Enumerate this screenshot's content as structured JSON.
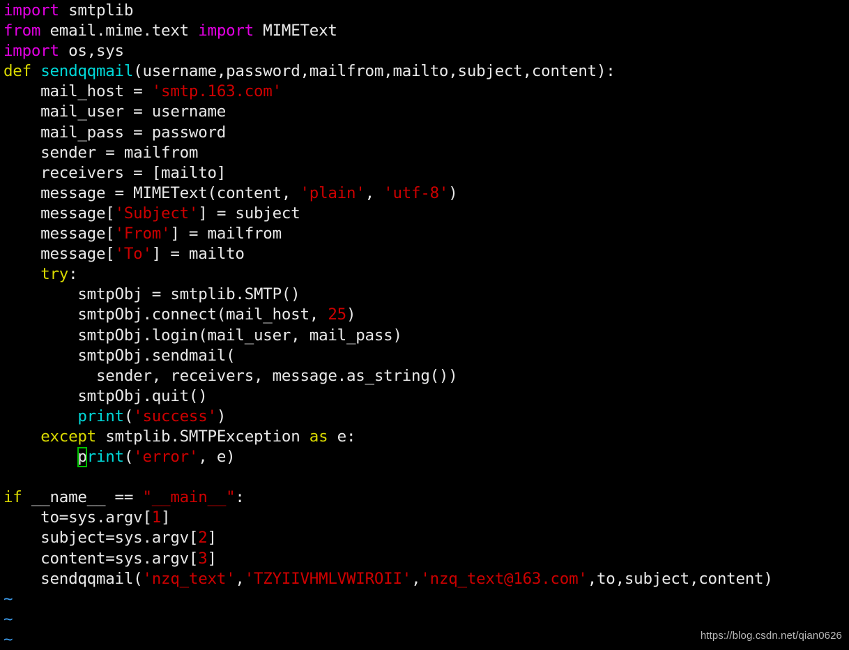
{
  "editor": {
    "app": "vim",
    "language": "python",
    "background_color": "#000000",
    "default_text_color": "#e8e8e8",
    "cursor": {
      "character": "p",
      "line": 21,
      "column": 9,
      "style": "hollow-box",
      "color": "#00c000"
    },
    "palette": {
      "keyword": "#d8d800",
      "import": "#e000e0",
      "function": "#00d7d7",
      "string": "#cc0000",
      "number": "#cc0000",
      "plain": "#e8e8e8",
      "tilde": "#3c9ae8"
    }
  },
  "code": {
    "lines": [
      [
        {
          "t": "import",
          "c": "imp"
        },
        {
          "t": " smtplib",
          "c": "plain"
        }
      ],
      [
        {
          "t": "from",
          "c": "imp"
        },
        {
          "t": " email.mime.text ",
          "c": "plain"
        },
        {
          "t": "import",
          "c": "imp"
        },
        {
          "t": " MIMEText",
          "c": "plain"
        }
      ],
      [
        {
          "t": "import",
          "c": "imp"
        },
        {
          "t": " os,sys",
          "c": "plain"
        }
      ],
      [
        {
          "t": "def",
          "c": "kw"
        },
        {
          "t": " ",
          "c": "plain"
        },
        {
          "t": "sendqqmail",
          "c": "fn"
        },
        {
          "t": "(username,password,mailfrom,mailto,subject,content):",
          "c": "plain"
        }
      ],
      [
        {
          "t": "    mail_host = ",
          "c": "plain"
        },
        {
          "t": "'smtp.163.com'",
          "c": "str"
        }
      ],
      [
        {
          "t": "    mail_user = username",
          "c": "plain"
        }
      ],
      [
        {
          "t": "    mail_pass = password",
          "c": "plain"
        }
      ],
      [
        {
          "t": "    sender = mailfrom",
          "c": "plain"
        }
      ],
      [
        {
          "t": "    receivers = [mailto]",
          "c": "plain"
        }
      ],
      [
        {
          "t": "    message = MIMEText(content, ",
          "c": "plain"
        },
        {
          "t": "'plain'",
          "c": "str"
        },
        {
          "t": ", ",
          "c": "plain"
        },
        {
          "t": "'utf-8'",
          "c": "str"
        },
        {
          "t": ")",
          "c": "plain"
        }
      ],
      [
        {
          "t": "    message[",
          "c": "plain"
        },
        {
          "t": "'Subject'",
          "c": "str"
        },
        {
          "t": "] = subject",
          "c": "plain"
        }
      ],
      [
        {
          "t": "    message[",
          "c": "plain"
        },
        {
          "t": "'From'",
          "c": "str"
        },
        {
          "t": "] = mailfrom",
          "c": "plain"
        }
      ],
      [
        {
          "t": "    message[",
          "c": "plain"
        },
        {
          "t": "'To'",
          "c": "str"
        },
        {
          "t": "] = mailto",
          "c": "plain"
        }
      ],
      [
        {
          "t": "    ",
          "c": "plain"
        },
        {
          "t": "try",
          "c": "kw"
        },
        {
          "t": ":",
          "c": "plain"
        }
      ],
      [
        {
          "t": "        smtpObj = smtplib.SMTP()",
          "c": "plain"
        }
      ],
      [
        {
          "t": "        smtpObj.connect(mail_host, ",
          "c": "plain"
        },
        {
          "t": "25",
          "c": "num"
        },
        {
          "t": ")",
          "c": "plain"
        }
      ],
      [
        {
          "t": "        smtpObj.login(mail_user, mail_pass)",
          "c": "plain"
        }
      ],
      [
        {
          "t": "        smtpObj.sendmail(",
          "c": "plain"
        }
      ],
      [
        {
          "t": "          sender, receivers, message.as_string())",
          "c": "plain"
        }
      ],
      [
        {
          "t": "        smtpObj.quit()",
          "c": "plain"
        }
      ],
      [
        {
          "t": "        ",
          "c": "plain"
        },
        {
          "t": "print",
          "c": "fn"
        },
        {
          "t": "(",
          "c": "plain"
        },
        {
          "t": "'success'",
          "c": "str"
        },
        {
          "t": ")",
          "c": "plain"
        }
      ],
      [
        {
          "t": "    ",
          "c": "plain"
        },
        {
          "t": "except",
          "c": "kw"
        },
        {
          "t": " smtplib.SMTPException ",
          "c": "plain"
        },
        {
          "t": "as",
          "c": "kw"
        },
        {
          "t": " e:",
          "c": "plain"
        }
      ],
      [
        {
          "t": "        ",
          "c": "plain"
        },
        {
          "t": "p",
          "c": "cursor"
        },
        {
          "t": "rint",
          "c": "fn"
        },
        {
          "t": "(",
          "c": "plain"
        },
        {
          "t": "'error'",
          "c": "str"
        },
        {
          "t": ", e)",
          "c": "plain"
        }
      ],
      [
        {
          "t": "",
          "c": "plain"
        }
      ],
      [
        {
          "t": "if",
          "c": "kw"
        },
        {
          "t": " __name__ == ",
          "c": "plain"
        },
        {
          "t": "\"__main__\"",
          "c": "str"
        },
        {
          "t": ":",
          "c": "plain"
        }
      ],
      [
        {
          "t": "    to=sys.argv[",
          "c": "plain"
        },
        {
          "t": "1",
          "c": "num"
        },
        {
          "t": "]",
          "c": "plain"
        }
      ],
      [
        {
          "t": "    subject=sys.argv[",
          "c": "plain"
        },
        {
          "t": "2",
          "c": "num"
        },
        {
          "t": "]",
          "c": "plain"
        }
      ],
      [
        {
          "t": "    content=sys.argv[",
          "c": "plain"
        },
        {
          "t": "3",
          "c": "num"
        },
        {
          "t": "]",
          "c": "plain"
        }
      ],
      [
        {
          "t": "    sendqqmail(",
          "c": "plain"
        },
        {
          "t": "'nzq_text'",
          "c": "str"
        },
        {
          "t": ",",
          "c": "plain"
        },
        {
          "t": "'TZYIIVHMLVWIROII'",
          "c": "str"
        },
        {
          "t": ",",
          "c": "plain"
        },
        {
          "t": "'nzq_text@163.com'",
          "c": "str"
        },
        {
          "t": ",to,subject,content)",
          "c": "plain"
        }
      ],
      [
        {
          "t": "~",
          "c": "tilde"
        }
      ],
      [
        {
          "t": "~",
          "c": "tilde"
        }
      ],
      [
        {
          "t": "~",
          "c": "tilde"
        }
      ]
    ]
  },
  "watermark": {
    "text": "https://blog.csdn.net/qian0626"
  }
}
